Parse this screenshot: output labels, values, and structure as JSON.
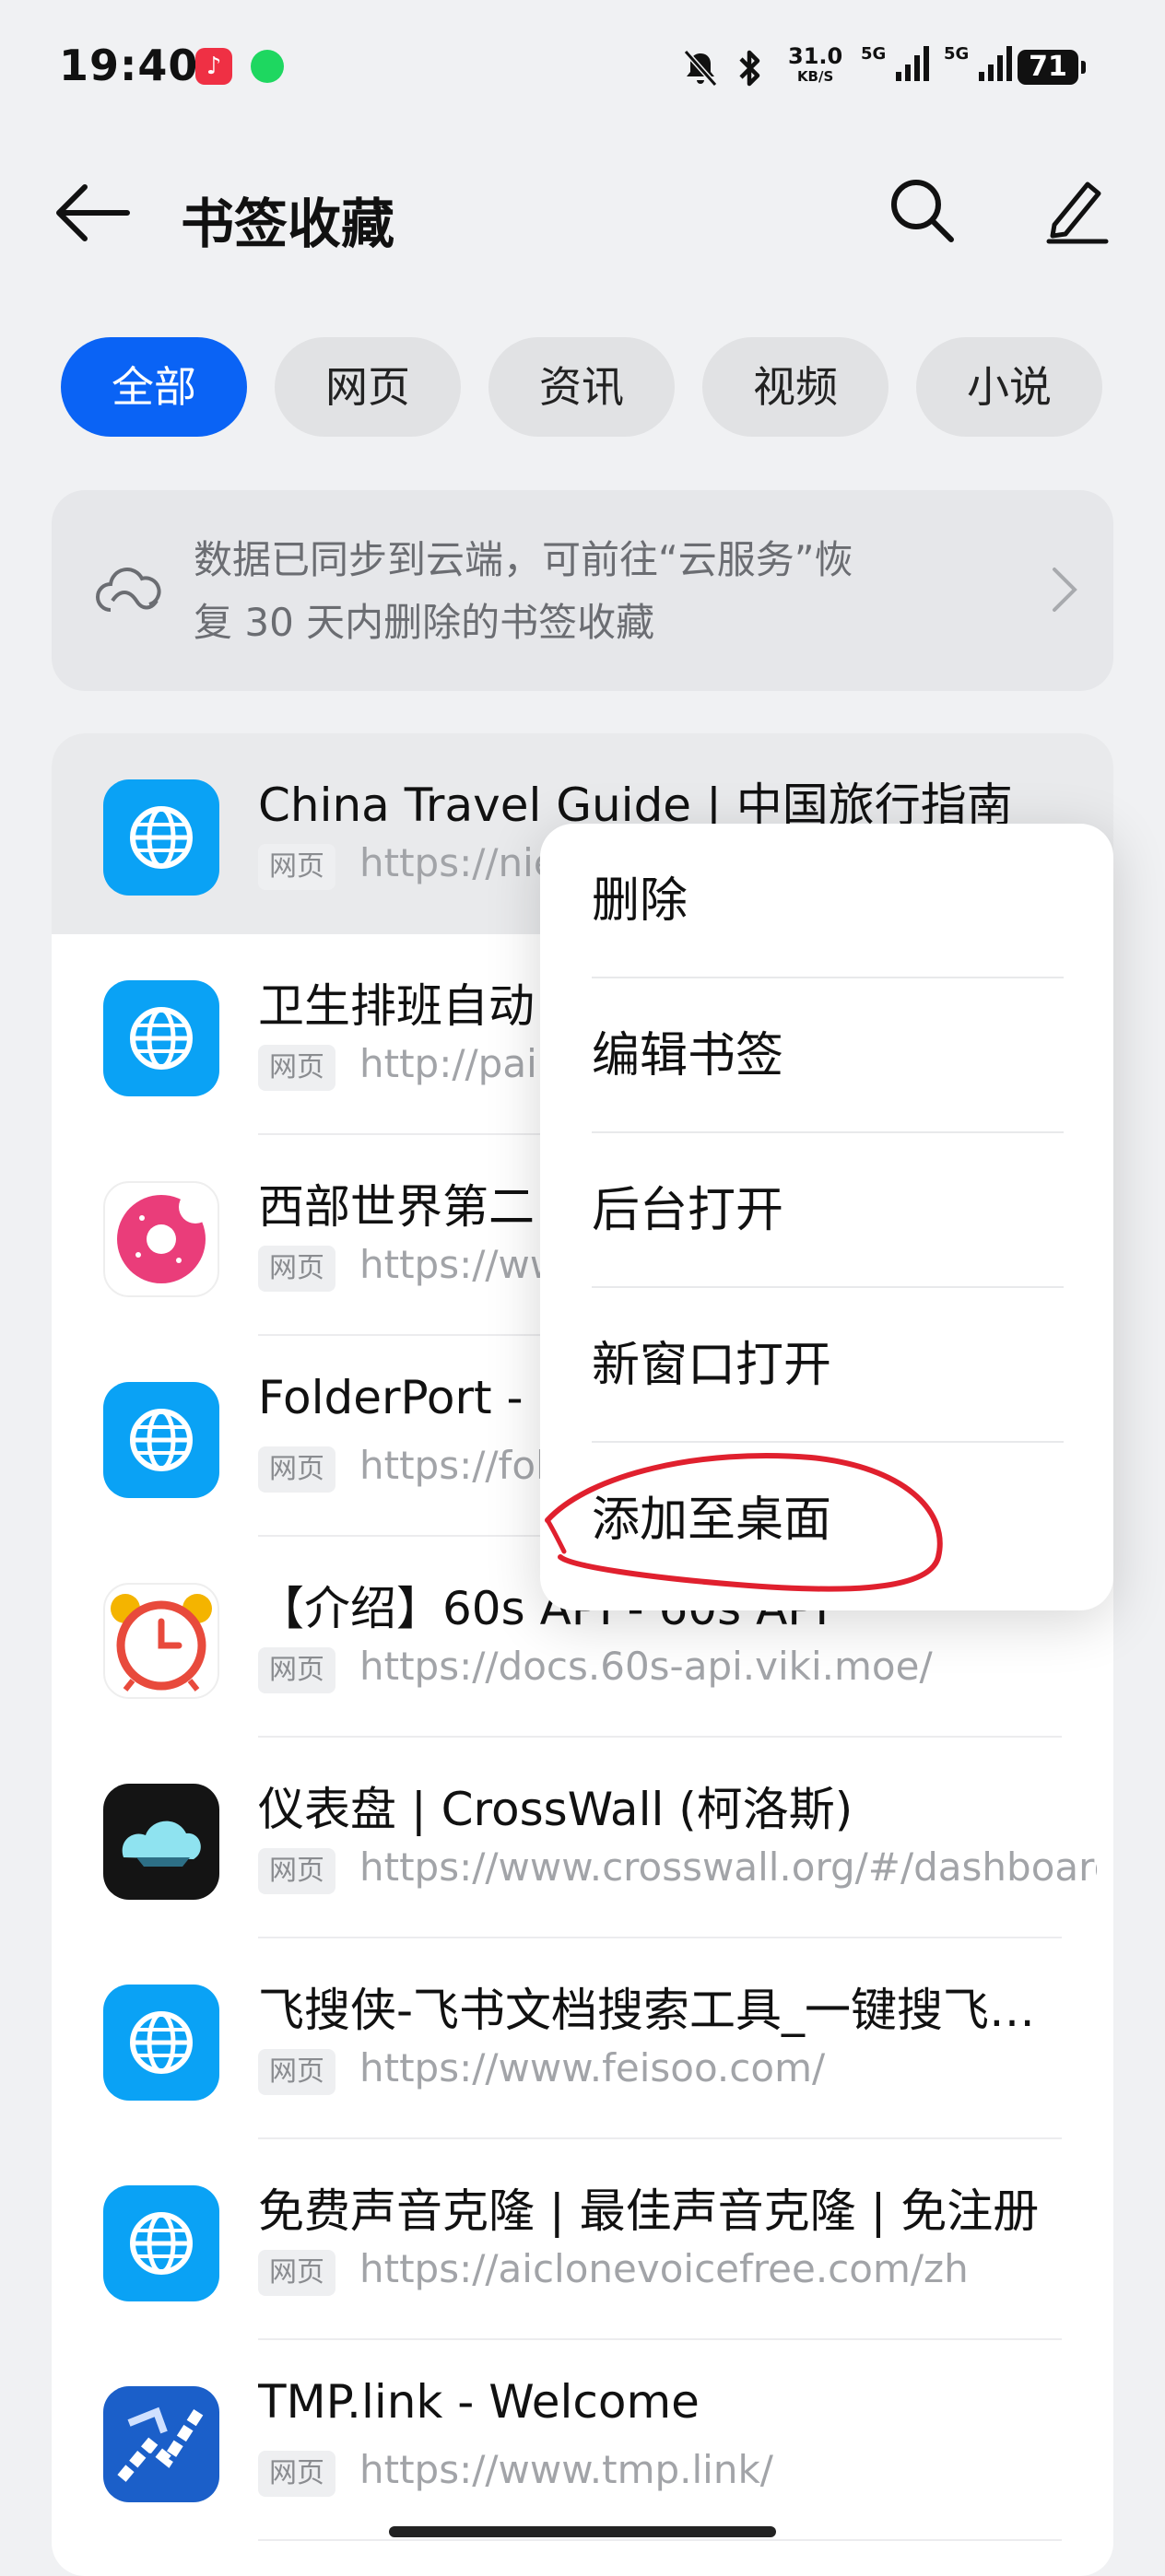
{
  "status_bar": {
    "time": "19:40",
    "net_speed_value": "31.0",
    "net_speed_unit": "KB/S",
    "sim1": "5G",
    "sim2": "5G",
    "battery": "71",
    "icons": [
      "music-app-icon",
      "spotify-icon",
      "mute-icon",
      "bluetooth-icon"
    ]
  },
  "header": {
    "title": "书签收藏",
    "back_icon": "back-arrow-icon",
    "search_icon": "search-icon",
    "edit_icon": "edit-pencil-icon"
  },
  "tabs": [
    {
      "label": "全部",
      "active": true
    },
    {
      "label": "网页",
      "active": false
    },
    {
      "label": "资讯",
      "active": false
    },
    {
      "label": "视频",
      "active": false
    },
    {
      "label": "小说",
      "active": false
    }
  ],
  "sync_banner": {
    "line1": "数据已同步到云端，可前往“云服务”恢",
    "line2": "复 30 天内删除的书签收藏"
  },
  "bookmarks": [
    {
      "title": "China Travel Guide | 中国旅行指南",
      "tag": "网页",
      "url": "https://niep",
      "icon": "globe-icon"
    },
    {
      "title": "卫生排班自动",
      "tag": "网页",
      "url": "http://paib",
      "icon": "globe-icon"
    },
    {
      "title": "西部世界第二",
      "tag": "网页",
      "url": "https://ww",
      "icon": "donut-logo-icon"
    },
    {
      "title": "FolderPort - I",
      "tag": "网页",
      "url": "https://fold",
      "icon": "globe-icon"
    },
    {
      "title": "【介绍】60s API - 60s API",
      "tag": "网页",
      "url": "https://docs.60s-api.viki.moe/",
      "icon": "alarm-clock-icon"
    },
    {
      "title": "仪表盘 | CrossWall (柯洛斯)",
      "tag": "网页",
      "url": "https://www.crosswall.org/#/dashboard",
      "icon": "crosswall-logo-icon"
    },
    {
      "title": "飞搜侠-飞书文档搜索工具_一键搜飞…",
      "tag": "网页",
      "url": "https://www.feisoo.com/",
      "icon": "globe-icon"
    },
    {
      "title": "免费声音克隆 | 最佳声音克隆 | 免注册",
      "tag": "网页",
      "url": "https://aiclonevoicefree.com/zh",
      "icon": "globe-icon"
    },
    {
      "title": "TMP.link - Welcome",
      "tag": "网页",
      "url": "https://www.tmp.link/",
      "icon": "tmplink-logo-icon"
    }
  ],
  "context_menu": {
    "items": [
      "删除",
      "编辑书签",
      "后台打开",
      "新窗口打开",
      "添加至桌面"
    ]
  },
  "colors": {
    "accent": "#0a63f5",
    "globe_icon_bg": "#0aa2f5",
    "annotation_red": "#e0202e"
  }
}
